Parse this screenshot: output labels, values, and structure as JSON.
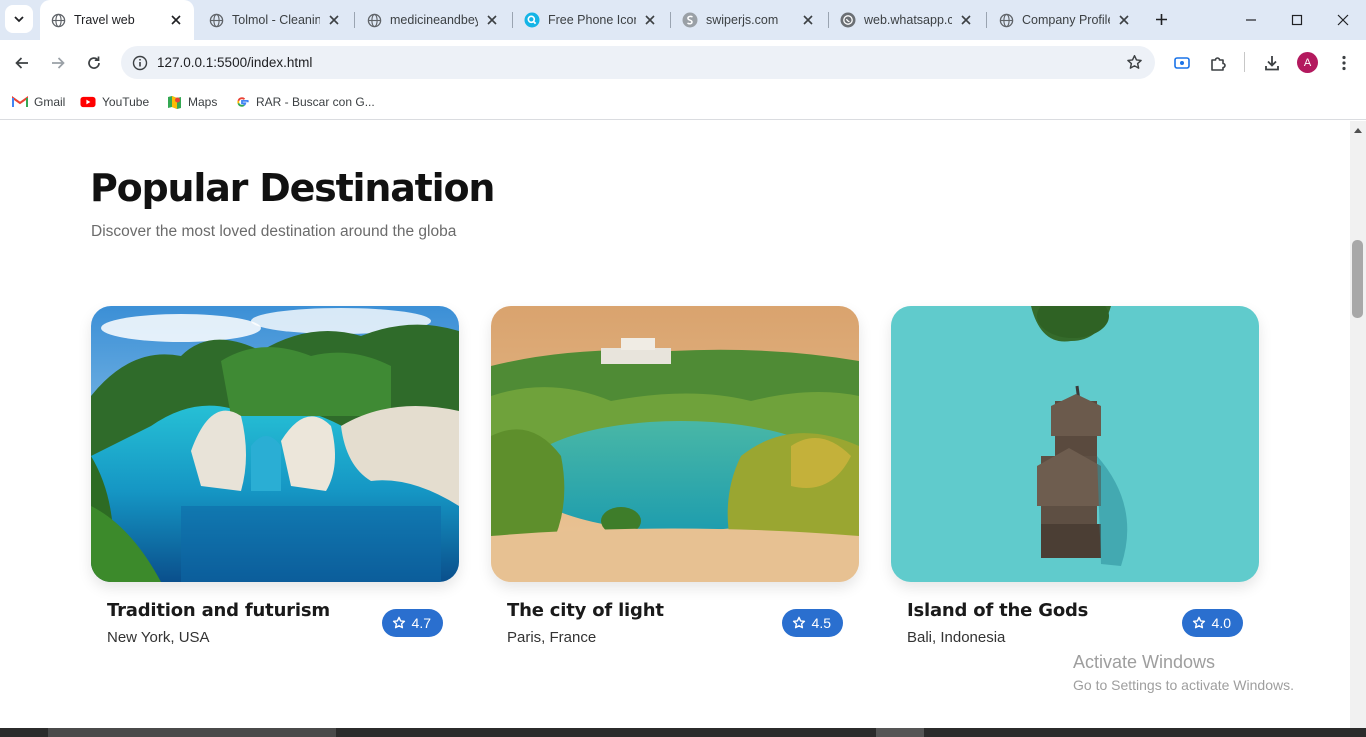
{
  "browser": {
    "tabs": [
      {
        "title": "Travel web",
        "active": true,
        "icon": "globe-icon"
      },
      {
        "title": "Tolmol - Cleanin",
        "active": false,
        "icon": "globe-icon"
      },
      {
        "title": "medicineandbey",
        "active": false,
        "icon": "globe-icon"
      },
      {
        "title": "Free Phone Icon",
        "active": false,
        "icon": "search-logo-icon"
      },
      {
        "title": "swiperjs.com",
        "active": false,
        "icon": "swiper-logo-icon"
      },
      {
        "title": "web.whatsapp.c",
        "active": false,
        "icon": "whatsapp-icon"
      },
      {
        "title": "Company Profile",
        "active": false,
        "icon": "globe-icon"
      }
    ],
    "url": "127.0.0.1:5500/index.html",
    "avatar_letter": "A",
    "bookmarks": [
      {
        "label": "Gmail",
        "icon": "gmail-icon"
      },
      {
        "label": "YouTube",
        "icon": "youtube-icon"
      },
      {
        "label": "Maps",
        "icon": "maps-icon"
      },
      {
        "label": "RAR - Buscar con G...",
        "icon": "google-icon"
      }
    ]
  },
  "section": {
    "title": "Popular Destination",
    "subtitle": "Discover the most loved destination around the globa"
  },
  "destinations": [
    {
      "name": "Tradition and futurism",
      "location": "New York, USA",
      "rating": "4.7"
    },
    {
      "name": "The city of light",
      "location": "Paris, France",
      "rating": "4.5"
    },
    {
      "name": "Island of the Gods",
      "location": "Bali, Indonesia",
      "rating": "4.0"
    }
  ],
  "watermark": {
    "line1": "Activate Windows",
    "line2": "Go to Settings to activate Windows."
  },
  "colors": {
    "rating_badge": "#2a6fcf",
    "tabstrip": "#dfe8f5",
    "omnibox": "#edf1f7"
  }
}
